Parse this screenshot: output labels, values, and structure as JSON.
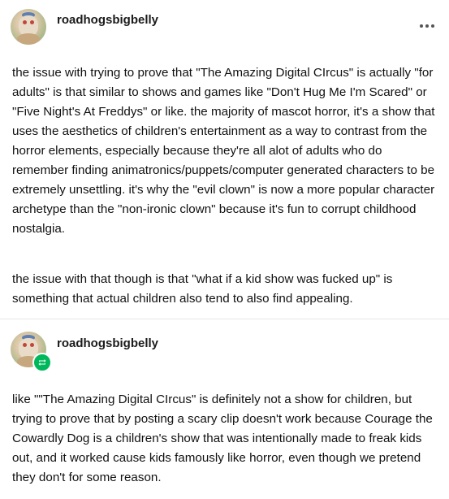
{
  "post1": {
    "username": "roadhogsbigbelly",
    "more_icon": "more-horizontal-icon",
    "paragraph1": "the issue with trying to prove that \"The Amazing Digital CIrcus\" is actually \"for adults\" is that similar to shows and games like \"Don't Hug Me I'm Scared\" or \"Five Night's At Freddys\" or like. the majority of mascot horror, it's a show that uses the aesthetics of children's entertainment as a way to contrast from the horror elements, especially because they're all alot of adults who do remember finding animatronics/puppets/computer generated characters to be extremely unsettling. it's why the \"evil clown\" is now a more popular character archetype than the \"non-ironic clown\" because it's fun to corrupt childhood nostalgia.",
    "paragraph2": "the issue with that though is that \"what if a kid show was fucked up\" is something that actual children also tend to also find appealing."
  },
  "post2": {
    "username": "roadhogsbigbelly",
    "badge_icon": "reblog-icon",
    "badge_color": "#00b85c",
    "paragraph1": "like \"\"The Amazing Digital CIrcus\" is definitely not a show for children, but trying to prove that by posting a scary clip doesn't work because Courage the Cowardly Dog is a children's show that was intentionally made to freak kids out, and it worked cause kids famously like horror, even though we pretend they don't for some reason."
  }
}
